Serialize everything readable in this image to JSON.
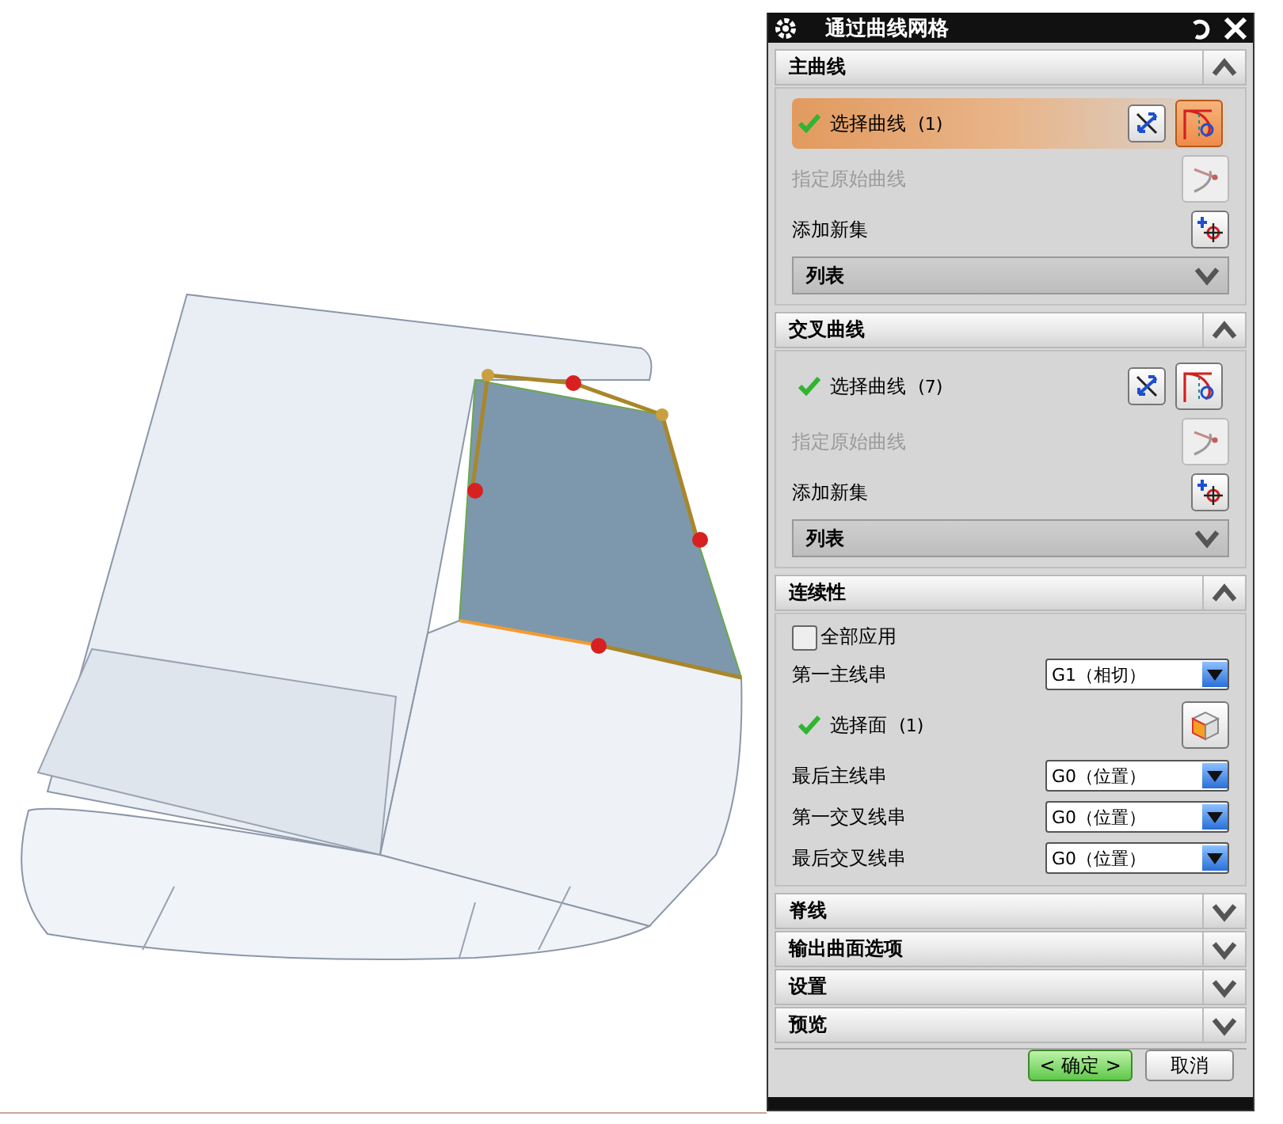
{
  "dialog": {
    "title": "通过曲线网格"
  },
  "sections": [
    {
      "kind": "curves",
      "title": "主曲线",
      "expanded": true,
      "select": {
        "label": "选择曲线",
        "count": "(1)",
        "done": true,
        "selected": true
      },
      "specify": {
        "label": "指定原始曲线",
        "disabled": true
      },
      "add_set": "添加新集",
      "list": {
        "label": "列表",
        "expanded": false
      }
    },
    {
      "kind": "curves",
      "title": "交叉曲线",
      "expanded": true,
      "select": {
        "label": "选择曲线",
        "count": "(7)",
        "done": true,
        "selected": false
      },
      "specify": {
        "label": "指定原始曲线",
        "disabled": true
      },
      "add_set": "添加新集",
      "list": {
        "label": "列表",
        "expanded": false
      }
    },
    {
      "kind": "continuity",
      "title": "连续性",
      "expanded": true,
      "apply_all": {
        "label": "全部应用",
        "checked": false
      },
      "rows": [
        {
          "kind": "dropdown",
          "label": "第一主线串",
          "value": "G1（相切）"
        },
        {
          "kind": "select",
          "label": "选择面",
          "count": "(1)",
          "done": true
        },
        {
          "kind": "dropdown",
          "label": "最后主线串",
          "value": "G0（位置）"
        },
        {
          "kind": "dropdown",
          "label": "第一交叉线串",
          "value": "G0（位置）"
        },
        {
          "kind": "dropdown",
          "label": "最后交叉线串",
          "value": "G0（位置）"
        }
      ]
    },
    {
      "kind": "plain",
      "title": "脊线",
      "expanded": false
    },
    {
      "kind": "plain",
      "title": "输出曲面选项",
      "expanded": false
    },
    {
      "kind": "plain",
      "title": "设置",
      "expanded": false
    },
    {
      "kind": "plain",
      "title": "预览",
      "expanded": false
    }
  ],
  "buttons": [
    {
      "label": "< 确定 >",
      "default": true
    },
    {
      "label": "取消",
      "default": false
    }
  ]
}
